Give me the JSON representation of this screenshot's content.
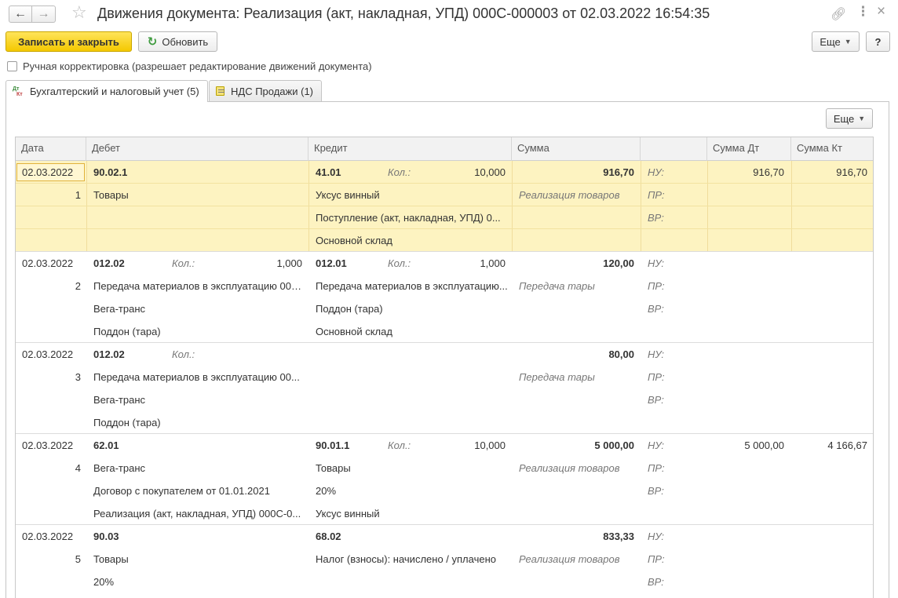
{
  "window": {
    "title": "Движения документа: Реализация (акт, накладная, УПД) 000С-000003 от 02.03.2022 16:54:35"
  },
  "toolbar": {
    "save_close": "Записать и закрыть",
    "refresh": "Обновить",
    "more": "Еще",
    "help": "?"
  },
  "manual_edit": {
    "label": "Ручная корректировка (разрешает редактирование движений документа)"
  },
  "tabs": [
    {
      "label": "Бухгалтерский и налоговый учет (5)",
      "active": true
    },
    {
      "label": "НДС Продажи (1)",
      "active": false
    }
  ],
  "icons": {
    "tab_accounting": "dt-kt-icon",
    "tab_vat": "vat-register-icon"
  },
  "panel": {
    "more": "Еще"
  },
  "grid": {
    "columns": [
      "Дата",
      "Дебет",
      "Кредит",
      "Сумма",
      "",
      "Сумма Дт",
      "Сумма Кт"
    ],
    "records": [
      {
        "date": "02.03.2022",
        "num": "1",
        "dt_account": "90.02.1",
        "dt_qty_label": "",
        "dt_qty": "",
        "dt_sub": [
          "Товары",
          "",
          ""
        ],
        "kt_account": "41.01",
        "kt_qty_label": "Кол.:",
        "kt_qty": "10,000",
        "kt_sub": [
          "Уксус винный",
          "Поступление (акт, накладная, УПД) 0...",
          "Основной склад"
        ],
        "sum": "916,70",
        "content": "Реализация товаров",
        "nu": "НУ:",
        "pr": "ПР:",
        "vr": "ВР:",
        "sum_dt": "916,70",
        "sum_kt": "916,70"
      },
      {
        "date": "02.03.2022",
        "num": "2",
        "dt_account": "012.02",
        "dt_qty_label": "Кол.:",
        "dt_qty": "1,000",
        "dt_sub": [
          "Передача материалов в эксплуатацию 000...",
          "Вега-транс",
          "Поддон (тара)"
        ],
        "kt_account": "012.01",
        "kt_qty_label": "Кол.:",
        "kt_qty": "1,000",
        "kt_sub": [
          "Передача материалов в эксплуатацию...",
          "Поддон (тара)",
          "Основной склад"
        ],
        "sum": "120,00",
        "content": "Передача тары",
        "nu": "НУ:",
        "pr": "ПР:",
        "vr": "ВР:",
        "sum_dt": "",
        "sum_kt": ""
      },
      {
        "date": "02.03.2022",
        "num": "3",
        "dt_account": "012.02",
        "dt_qty_label": "Кол.:",
        "dt_qty": "",
        "dt_sub": [
          "Передача материалов в эксплуатацию 00...",
          "Вега-транс",
          "Поддон (тара)"
        ],
        "kt_account": "",
        "kt_qty_label": "",
        "kt_qty": "",
        "kt_sub": [
          "",
          "",
          ""
        ],
        "sum": "80,00",
        "content": "Передача тары",
        "nu": "НУ:",
        "pr": "ПР:",
        "vr": "ВР:",
        "sum_dt": "",
        "sum_kt": ""
      },
      {
        "date": "02.03.2022",
        "num": "4",
        "dt_account": "62.01",
        "dt_qty_label": "",
        "dt_qty": "",
        "dt_sub": [
          "Вега-транс",
          "Договор с покупателем от 01.01.2021",
          "Реализация (акт, накладная, УПД) 000С-0..."
        ],
        "kt_account": "90.01.1",
        "kt_qty_label": "Кол.:",
        "kt_qty": "10,000",
        "kt_sub": [
          "Товары",
          "20%",
          "Уксус винный"
        ],
        "sum": "5 000,00",
        "content": "Реализация товаров",
        "nu": "НУ:",
        "pr": "ПР:",
        "vr": "ВР:",
        "sum_dt": "5 000,00",
        "sum_kt": "4 166,67"
      },
      {
        "date": "02.03.2022",
        "num": "5",
        "dt_account": "90.03",
        "dt_qty_label": "",
        "dt_qty": "",
        "dt_sub": [
          "Товары",
          "20%",
          ""
        ],
        "kt_account": "68.02",
        "kt_qty_label": "",
        "kt_qty": "",
        "kt_sub": [
          "Налог (взносы): начислено / уплачено",
          "",
          ""
        ],
        "sum": "833,33",
        "content": "Реализация товаров",
        "nu": "НУ:",
        "pr": "ПР:",
        "vr": "ВР:",
        "sum_dt": "",
        "sum_kt": ""
      }
    ]
  }
}
